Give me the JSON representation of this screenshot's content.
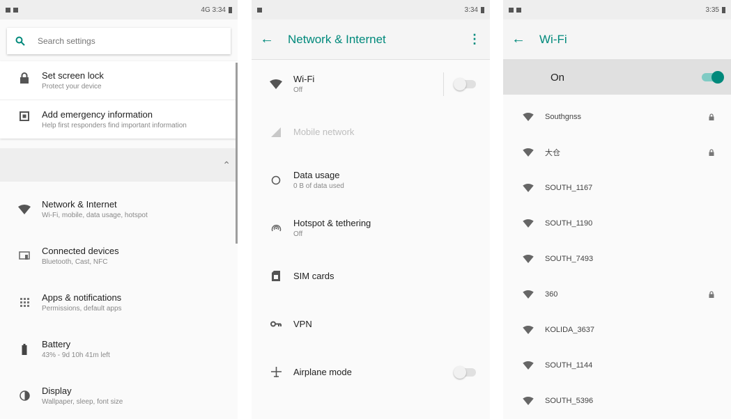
{
  "s1": {
    "status": {
      "right": "4G 3:34"
    },
    "search": {
      "placeholder": "Search settings"
    },
    "suggestions": [
      {
        "title": "Set screen lock",
        "subtitle": "Protect your device"
      },
      {
        "title": "Add emergency information",
        "subtitle": "Help first responders find important information"
      }
    ],
    "items": [
      {
        "title": "Network & Internet",
        "subtitle": "Wi-Fi, mobile, data usage, hotspot"
      },
      {
        "title": "Connected devices",
        "subtitle": "Bluetooth, Cast, NFC"
      },
      {
        "title": "Apps & notifications",
        "subtitle": "Permissions, default apps"
      },
      {
        "title": "Battery",
        "subtitle": "43% - 9d 10h 41m left"
      },
      {
        "title": "Display",
        "subtitle": "Wallpaper, sleep, font size"
      }
    ]
  },
  "s2": {
    "status": {
      "right": "3:34"
    },
    "title": "Network & Internet",
    "items": [
      {
        "title": "Wi-Fi",
        "subtitle": "Off"
      },
      {
        "title": "Mobile network",
        "subtitle": ""
      },
      {
        "title": "Data usage",
        "subtitle": "0 B of data used"
      },
      {
        "title": "Hotspot & tethering",
        "subtitle": "Off"
      },
      {
        "title": "SIM cards",
        "subtitle": ""
      },
      {
        "title": "VPN",
        "subtitle": ""
      },
      {
        "title": "Airplane mode",
        "subtitle": ""
      }
    ]
  },
  "s3": {
    "status": {
      "right": "3:35"
    },
    "title": "Wi-Fi",
    "on_label": "On",
    "networks": [
      {
        "name": "Southgnss",
        "locked": true
      },
      {
        "name": "大仓",
        "locked": true
      },
      {
        "name": "SOUTH_1167",
        "locked": false
      },
      {
        "name": "SOUTH_1190",
        "locked": false
      },
      {
        "name": "SOUTH_7493",
        "locked": false
      },
      {
        "name": "360",
        "locked": true
      },
      {
        "name": "KOLIDA_3637",
        "locked": false
      },
      {
        "name": "SOUTH_1144",
        "locked": false
      },
      {
        "name": "SOUTH_5396",
        "locked": false
      }
    ]
  },
  "accent": "#00897b"
}
